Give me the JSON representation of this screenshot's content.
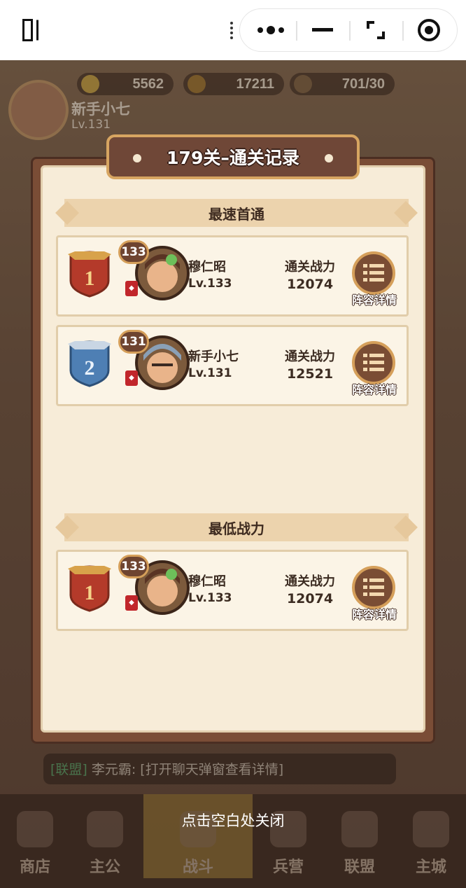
{
  "resources": [
    {
      "name": "gold-icon",
      "value": "5562"
    },
    {
      "name": "coin-icon",
      "value": "17211"
    },
    {
      "name": "food-icon",
      "value": "701/30"
    }
  ],
  "player": {
    "name": "新手小七",
    "level": "Lv.131"
  },
  "modal": {
    "title": "179关–通关记录",
    "section_fastest": "最速首通",
    "section_lowest": "最低战力",
    "power_label": "通关战力",
    "detail_label": "阵容详情"
  },
  "fastest": [
    {
      "rank": "1",
      "badge": "133",
      "name": "穆仁昭",
      "level": "Lv.133",
      "power": "12074"
    },
    {
      "rank": "2",
      "badge": "131",
      "name": "新手小七",
      "level": "Lv.131",
      "power": "12521"
    }
  ],
  "lowest": [
    {
      "rank": "1",
      "badge": "133",
      "name": "穆仁昭",
      "level": "Lv.133",
      "power": "12074"
    }
  ],
  "chat": {
    "tag": "[联盟]",
    "text": " 李元霸: [打开聊天弹窗查看详情]"
  },
  "nav": [
    "商店",
    "主公",
    "战斗",
    "兵营",
    "联盟",
    "主城"
  ],
  "close_hint": "点击空白处关闭",
  "colors": {
    "gold_shield": "#b43a2a",
    "silver_shield": "#4e7fb4",
    "modal_frame": "#7a4d36",
    "parchment": "#f7ecd8"
  }
}
